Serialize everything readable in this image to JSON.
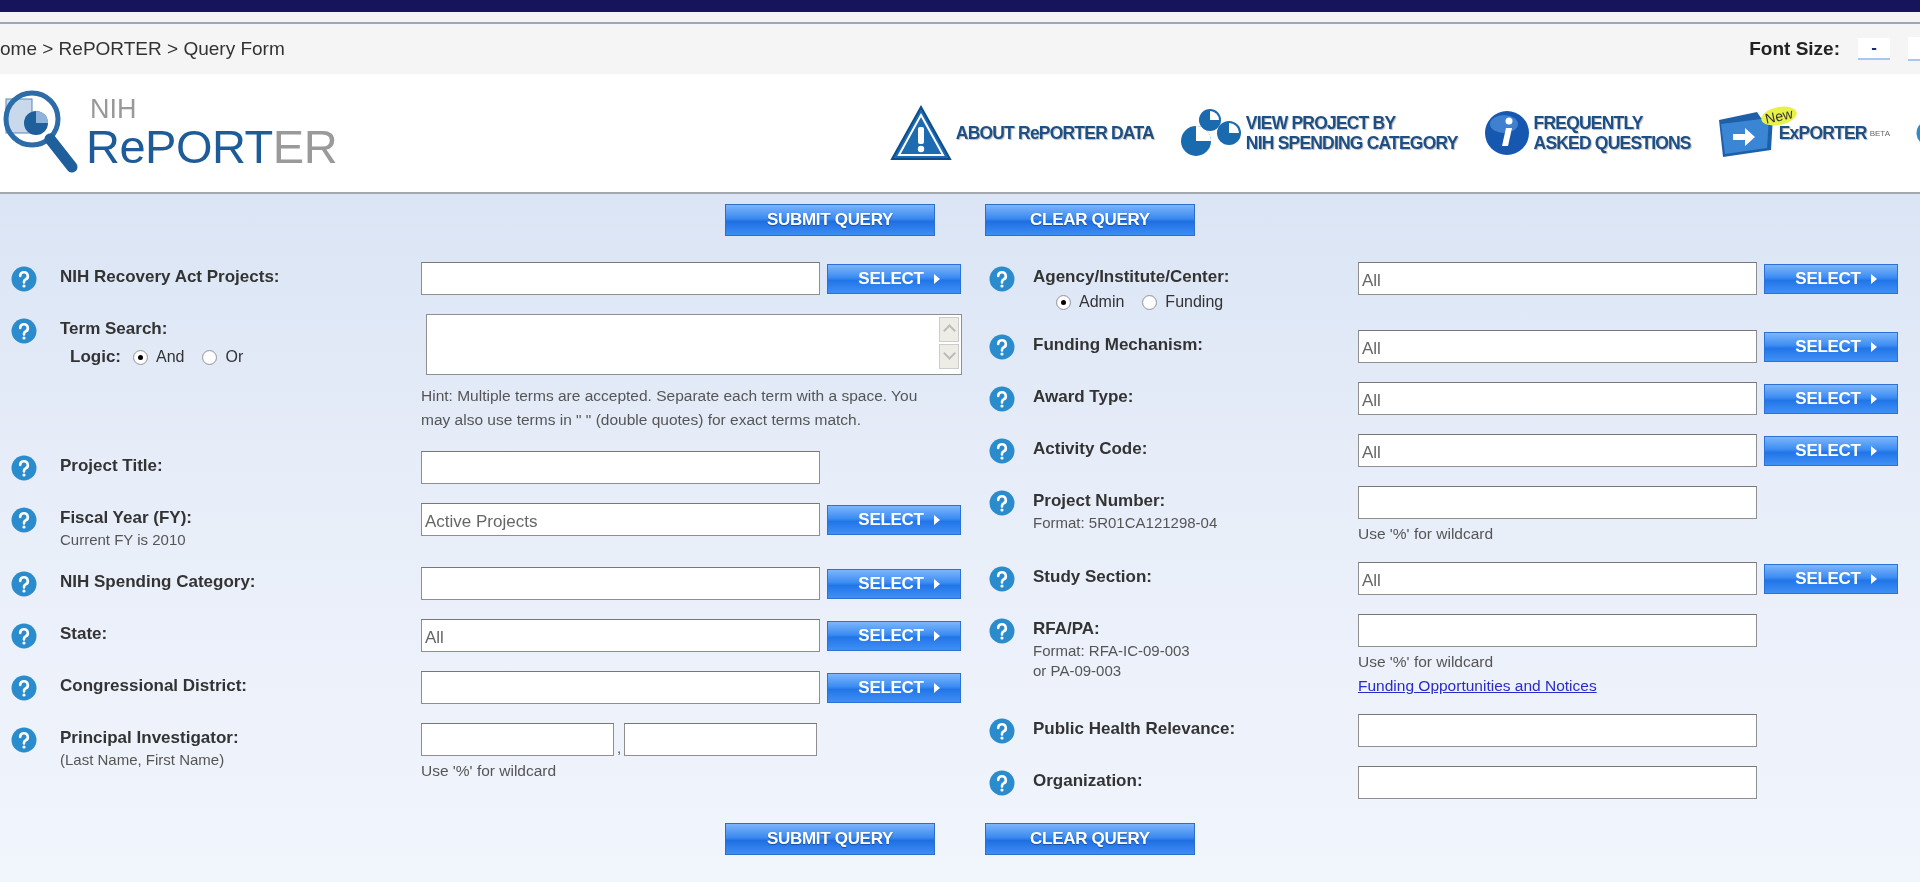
{
  "breadcrumb": "ome > RePORTER > Query Form",
  "font_size": {
    "label": "Font Size:",
    "button": "-"
  },
  "logo": {
    "small": "NIH",
    "main": "RePORT",
    "tail": "ER"
  },
  "nav": [
    {
      "kind": "about",
      "lines": [
        "ABOUT RePORTER DATA"
      ]
    },
    {
      "kind": "category",
      "lines": [
        "VIEW PROJECT BY",
        "NIH SPENDING CATEGORY"
      ]
    },
    {
      "kind": "faq",
      "lines": [
        "FREQUENTLY",
        "ASKED QUESTIONS"
      ]
    },
    {
      "kind": "exporter",
      "lines": [
        "ExPORTER"
      ],
      "badge": "New",
      "sup": "BETA"
    },
    {
      "kind": "help"
    }
  ],
  "buttons_top": [
    "SUBMIT QUERY",
    "CLEAR QUERY"
  ],
  "left_fields": [
    {
      "kind": "input",
      "label": "NIH Recovery Act Projects:",
      "select": "SELECT"
    },
    {
      "kind": "textarea",
      "label": "Term Search:",
      "options_label": "Logic:",
      "options": [
        {
          "label": "And",
          "selected": true
        },
        {
          "label": "Or",
          "selected": false
        }
      ],
      "hint": "Hint: Multiple terms are accepted. Separate each term with a space. You may also use terms in \" \" (double quotes) for exact terms match."
    },
    {
      "kind": "input",
      "label": "Project Title:"
    },
    {
      "kind": "input",
      "label": "Fiscal Year (FY):",
      "sublabel": [
        "Current FY is 2010"
      ],
      "value": "Active Projects",
      "select": "SELECT"
    },
    {
      "kind": "input",
      "label": "NIH Spending Category:",
      "select": "SELECT"
    },
    {
      "kind": "input",
      "label": "State:",
      "value": "All",
      "select": "SELECT"
    },
    {
      "kind": "input",
      "label": "Congressional District:",
      "select": "SELECT"
    },
    {
      "kind": "name",
      "label": "Principal Investigator:",
      "sublabel": [
        "(Last Name, First Name)"
      ],
      "separator": ",",
      "note": "Use '%' for wildcard"
    }
  ],
  "right_fields": [
    {
      "kind": "input",
      "label": "Agency/Institute/Center:",
      "options": [
        {
          "label": "Admin",
          "selected": true
        },
        {
          "label": "Funding",
          "selected": false
        }
      ],
      "value": "All",
      "select": "SELECT"
    },
    {
      "kind": "input",
      "label": "Funding Mechanism:",
      "value": "All",
      "select": "SELECT"
    },
    {
      "kind": "input",
      "label": "Award Type:",
      "value": "All",
      "select": "SELECT"
    },
    {
      "kind": "input",
      "label": "Activity Code:",
      "value": "All",
      "select": "SELECT"
    },
    {
      "kind": "input",
      "label": "Project Number:",
      "sublabel": [
        "Format: 5R01CA121298-04"
      ],
      "note": "Use '%' for wildcard"
    },
    {
      "kind": "input",
      "label": "Study Section:",
      "value": "All",
      "select": "SELECT"
    },
    {
      "kind": "input",
      "label": "RFA/PA:",
      "sublabel": [
        "Format: RFA-IC-09-003",
        "or PA-09-003"
      ],
      "note": "Use '%' for wildcard",
      "link": "Funding Opportunities and Notices"
    },
    {
      "kind": "input",
      "label": "Public Health Relevance:"
    },
    {
      "kind": "input",
      "label": "Organization:"
    }
  ],
  "buttons_bottom": [
    "SUBMIT QUERY",
    "CLEAR QUERY"
  ]
}
